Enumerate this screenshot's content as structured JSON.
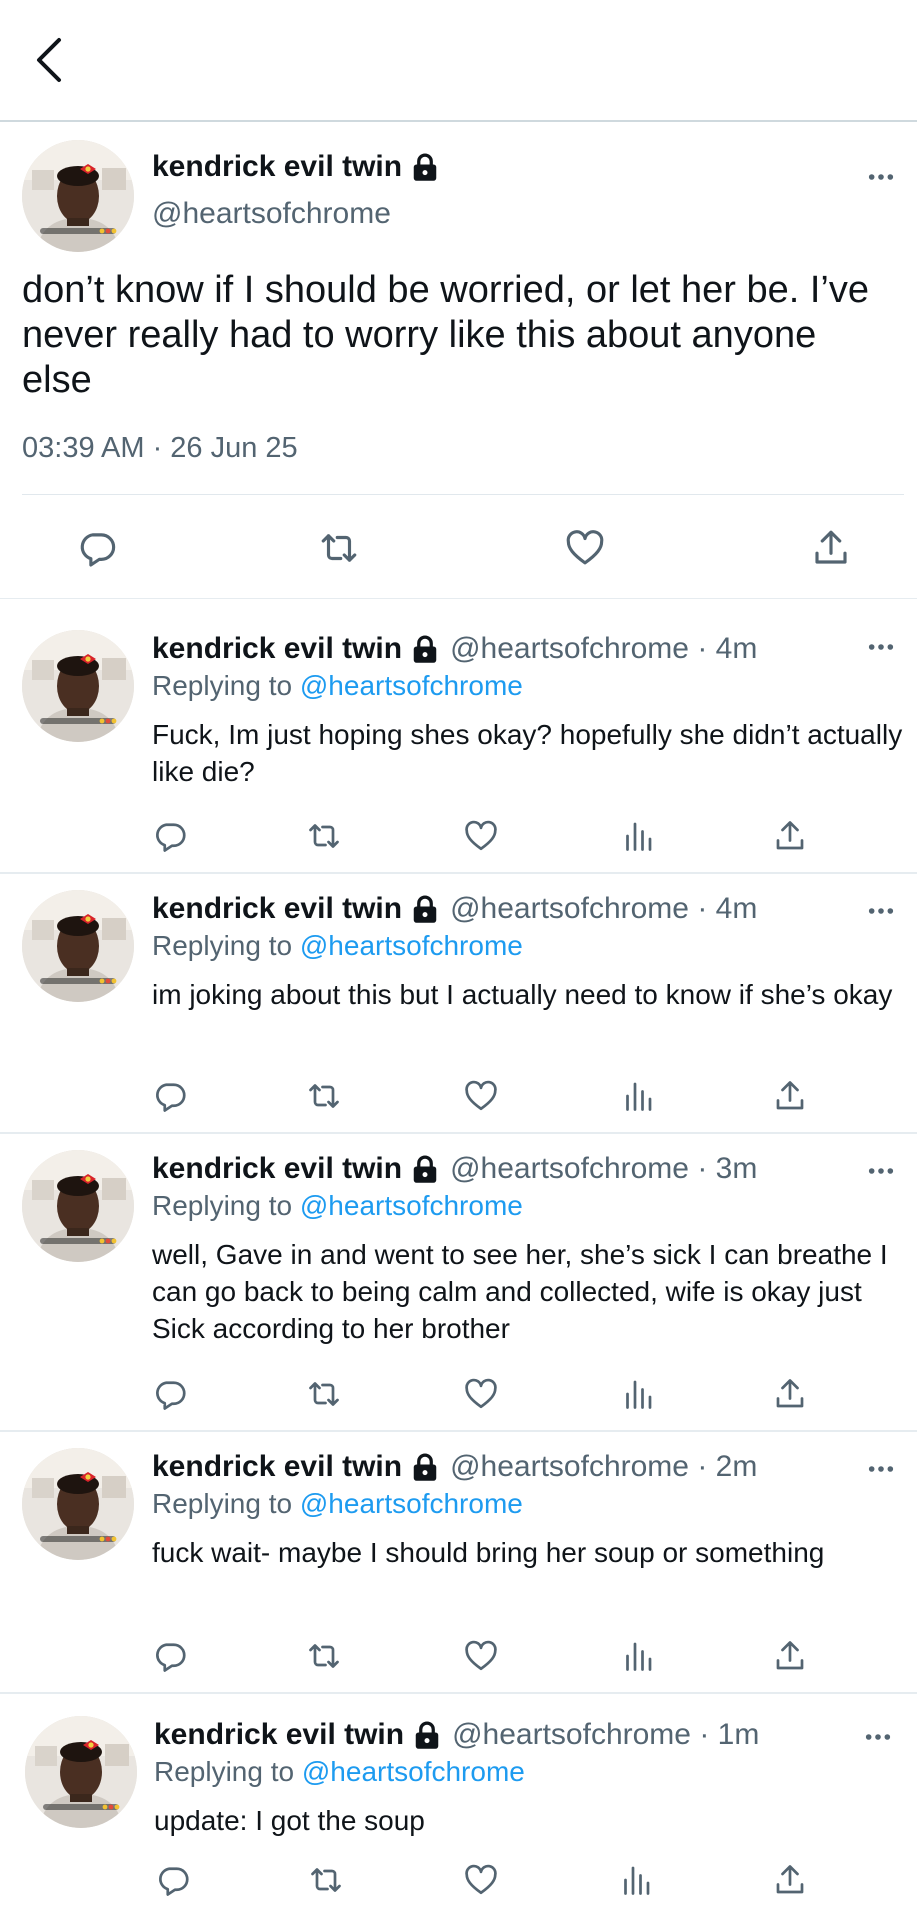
{
  "header": {
    "back_icon": "chevron-left-icon"
  },
  "main_tweet": {
    "name": "kendrick evil twin",
    "handle": "@heartsofchrome",
    "text": "don’t know if I should be worried, or let her be. I’ve never really had to worry like this about anyone else",
    "timestamp": "03:39 AM · 26 Jun 25"
  },
  "replies": [
    {
      "name": "kendrick evil twin",
      "meta": "@heartsofchrome · 4m",
      "replying_label": "Replying to ",
      "replying_handle": "@heartsofchrome",
      "text": "Fuck, Im just hoping shes okay? hopefully she didn’t actually like die?"
    },
    {
      "name": "kendrick evil twin",
      "meta": "@heartsofchrome · 4m",
      "replying_label": "Replying to ",
      "replying_handle": "@heartsofchrome",
      "text": "im joking about this but I actually need to know if she’s okay"
    },
    {
      "name": "kendrick evil twin",
      "meta": "@heartsofchrome · 3m",
      "replying_label": "Replying to ",
      "replying_handle": "@heartsofchrome",
      "text": "well, Gave in and went to see her, she’s sick I can breathe I can go back to being calm and collected, wife is okay just Sick according to her brother"
    },
    {
      "name": "kendrick evil twin",
      "meta": "@heartsofchrome · 2m",
      "replying_label": "Replying to ",
      "replying_handle": "@heartsofchrome",
      "text": "fuck wait- maybe I should bring her soup or something"
    },
    {
      "name": "kendrick evil twin",
      "meta": "@heartsofchrome · 1m",
      "replying_label": "Replying to ",
      "replying_handle": "@heartsofchrome",
      "text": "update: I got the soup"
    }
  ],
  "colors": {
    "text": "#0f1419",
    "secondary": "#536471",
    "link": "#1d9bf0",
    "divider": "#e6ecf0"
  }
}
